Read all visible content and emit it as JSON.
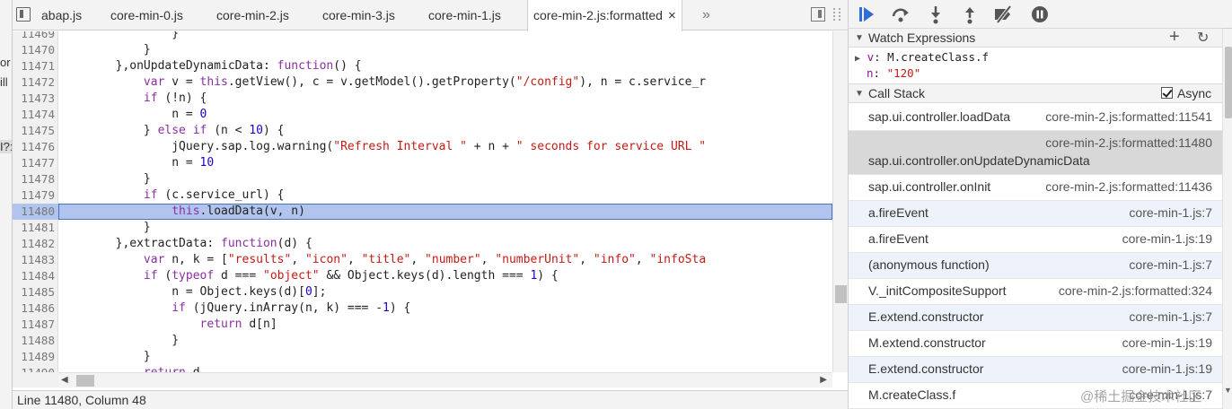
{
  "left_strip": {
    "fragments": [
      "or",
      "ill",
      "I?:"
    ]
  },
  "tabs": [
    {
      "label": "abap.js"
    },
    {
      "label": "core-min-0.js"
    },
    {
      "label": "core-min-2.js"
    },
    {
      "label": "core-min-3.js"
    },
    {
      "label": "core-min-1.js"
    },
    {
      "label": "core-min-2.js:formatted",
      "close": "×"
    }
  ],
  "tabs_more": "»",
  "editor": {
    "highlighted_line": "11480",
    "lines": [
      {
        "n": "11469",
        "c": "                }"
      },
      {
        "n": "11470",
        "c": "            }"
      },
      {
        "n": "11471",
        "c": "        },onUpdateDynamicData: function() {"
      },
      {
        "n": "11472",
        "c": "            var v = this.getView(), c = v.getModel().getProperty(\"/config\"), n = c.service_r"
      },
      {
        "n": "11473",
        "c": "            if (!n) {"
      },
      {
        "n": "11474",
        "c": "                n = 0"
      },
      {
        "n": "11475",
        "c": "            } else if (n < 10) {"
      },
      {
        "n": "11476",
        "c": "                jQuery.sap.log.warning(\"Refresh Interval \" + n + \" seconds for service URL \""
      },
      {
        "n": "11477",
        "c": "                n = 10"
      },
      {
        "n": "11478",
        "c": "            }"
      },
      {
        "n": "11479",
        "c": "            if (c.service_url) {"
      },
      {
        "n": "11480",
        "c": "                this.loadData(v, n)"
      },
      {
        "n": "11481",
        "c": "            }"
      },
      {
        "n": "11482",
        "c": "        },extractData: function(d) {"
      },
      {
        "n": "11483",
        "c": "            var n, k = [\"results\", \"icon\", \"title\", \"number\", \"numberUnit\", \"info\", \"infoSta"
      },
      {
        "n": "11484",
        "c": "            if (typeof d === \"object\" && Object.keys(d).length === 1) {"
      },
      {
        "n": "11485",
        "c": "                n = Object.keys(d)[0];"
      },
      {
        "n": "11486",
        "c": "                if (jQuery.inArray(n, k) === -1) {"
      },
      {
        "n": "11487",
        "c": "                    return d[n]"
      },
      {
        "n": "11488",
        "c": "                }"
      },
      {
        "n": "11489",
        "c": "            }"
      },
      {
        "n": "11490",
        "c": "            return d"
      },
      {
        "n": "11491",
        "c": ""
      }
    ]
  },
  "status_bar": {
    "text": "Line 11480, Column 48"
  },
  "watch": {
    "title": "Watch Expressions",
    "add_icon": "+",
    "refresh_icon": "↻",
    "entries": [
      {
        "name": "v",
        "value": "M.createClass.f"
      },
      {
        "name": "n",
        "value": "\"120\""
      }
    ]
  },
  "callstack": {
    "title": "Call Stack",
    "async_label": "Async",
    "async_checked": true,
    "frames": [
      {
        "fn": "sap.ui.controller.loadData",
        "loc": "core-min-2.js:formatted:11541",
        "state": "normal"
      },
      {
        "fn": "sap.ui.controller.onUpdateDynamicData",
        "loc": "core-min-2.js:formatted:11480",
        "state": "selected"
      },
      {
        "fn": "sap.ui.controller.onInit",
        "loc": "core-min-2.js:formatted:11436",
        "state": "normal"
      },
      {
        "fn": "a.fireEvent",
        "loc": "core-min-1.js:7",
        "state": "async"
      },
      {
        "fn": "a.fireEvent",
        "loc": "core-min-1.js:19",
        "state": "normal"
      },
      {
        "fn": "(anonymous function)",
        "loc": "core-min-1.js:7",
        "state": "async"
      },
      {
        "fn": "V._initCompositeSupport",
        "loc": "core-min-2.js:formatted:324",
        "state": "normal"
      },
      {
        "fn": "E.extend.constructor",
        "loc": "core-min-1.js:7",
        "state": "async"
      },
      {
        "fn": "M.extend.constructor",
        "loc": "core-min-1.js:19",
        "state": "normal"
      },
      {
        "fn": "E.extend.constructor",
        "loc": "core-min-1.js:19",
        "state": "async"
      },
      {
        "fn": "M.createClass.f",
        "loc": "core-min-1.js:7",
        "state": "normal"
      }
    ]
  },
  "watermark": "@稀土掘金技术社区",
  "colors": {
    "highlight_line": "#b0c4ee",
    "selected_frame": "#d8d8d8",
    "async_frame": "#edf2fb",
    "debugger_blue": "#2e6cd6"
  }
}
